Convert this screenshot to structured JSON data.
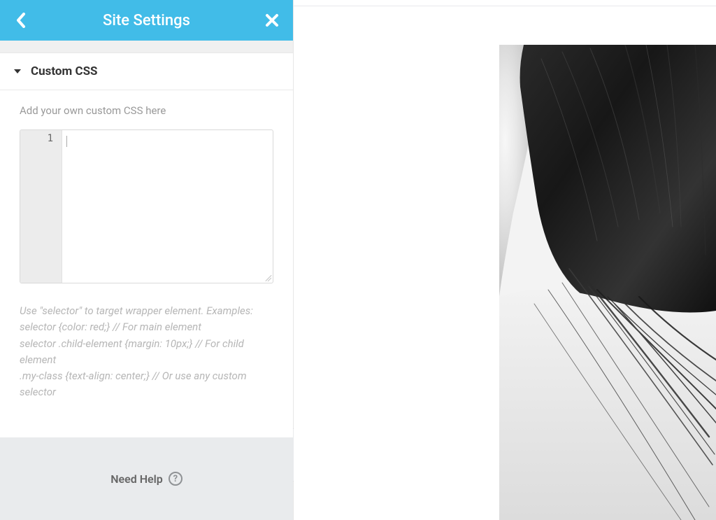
{
  "header": {
    "title": "Site Settings"
  },
  "section": {
    "title": "Custom CSS",
    "helper_text": "Add your own custom CSS here",
    "editor": {
      "line_number": "1",
      "content": ""
    },
    "hint_text": "Use \"selector\" to target wrapper element. Examples:\nselector {color: red;} // For main element\nselector .child-element {margin: 10px;} // For child element\n.my-class {text-align: center;} // Or use any custom selector"
  },
  "footer": {
    "help_label": "Need Help"
  },
  "collapse_glyph": "‹"
}
